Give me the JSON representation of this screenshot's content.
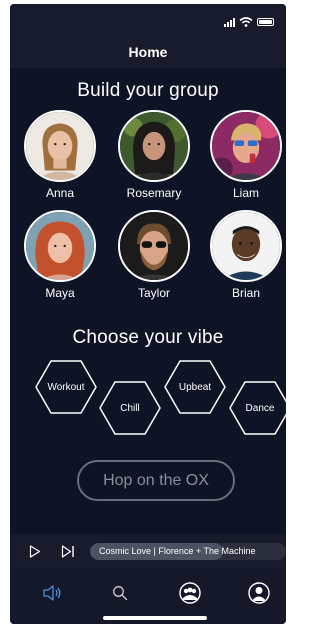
{
  "app": {
    "title": "Home",
    "accent_color": "#4a90e2",
    "background_color": "#0e1326"
  },
  "status_bar": {
    "icons": [
      "cellular-signal-icon",
      "wifi-icon",
      "battery-icon"
    ]
  },
  "group_section": {
    "title": "Build your group",
    "people": [
      {
        "name": "Anna"
      },
      {
        "name": "Rosemary"
      },
      {
        "name": "Liam"
      },
      {
        "name": "Maya"
      },
      {
        "name": "Taylor"
      },
      {
        "name": "Brian"
      }
    ]
  },
  "vibe_section": {
    "title": "Choose your vibe",
    "vibes": [
      {
        "label": "Workout"
      },
      {
        "label": "Chill"
      },
      {
        "label": "Upbeat"
      },
      {
        "label": "Dance"
      }
    ]
  },
  "cta": {
    "label": "Hop on the OX"
  },
  "player": {
    "track": "Cosmic Love | Florence + The Machine",
    "progress": 0.68
  },
  "tab_bar": {
    "tabs": [
      {
        "icon": "speaker-icon",
        "active": true
      },
      {
        "icon": "search-icon",
        "active": false
      },
      {
        "icon": "group-icon",
        "active": false
      },
      {
        "icon": "profile-icon",
        "active": false
      }
    ]
  }
}
